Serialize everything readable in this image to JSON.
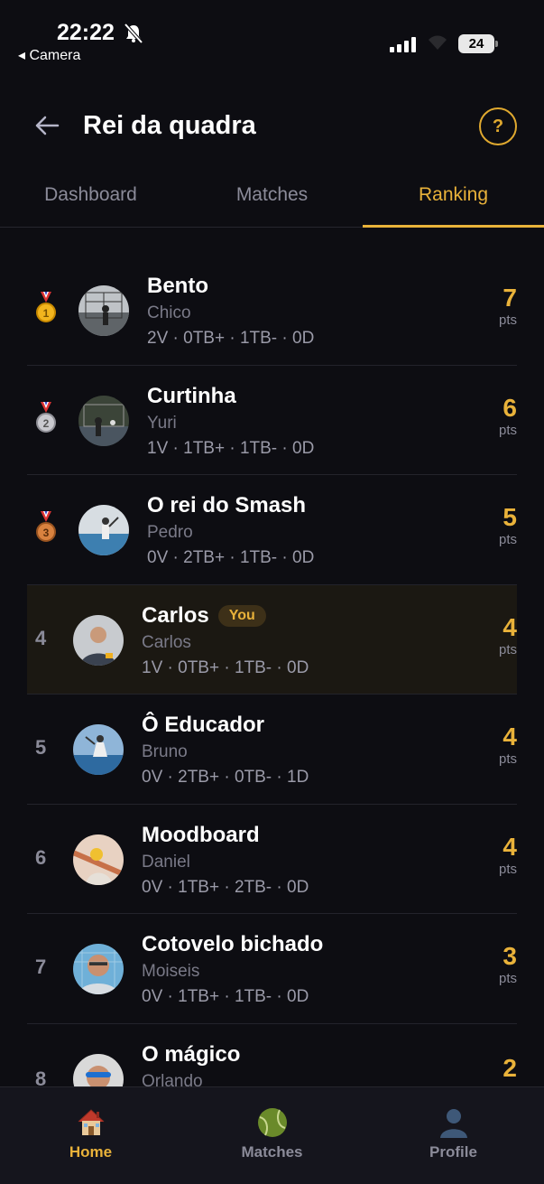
{
  "status": {
    "time": "22:22",
    "back_app": "◂ Camera",
    "battery": "24"
  },
  "header": {
    "title": "Rei da quadra",
    "help": "?"
  },
  "tabs": [
    {
      "label": "Dashboard",
      "active": false
    },
    {
      "label": "Matches",
      "active": false
    },
    {
      "label": "Ranking",
      "active": true
    }
  ],
  "ranking": [
    {
      "rank": "1",
      "medal": "gold",
      "name": "Bento",
      "player": "Chico",
      "stats": "2V · 0TB+ · 1TB- · 0D",
      "pts": "7",
      "pts_label": "pts"
    },
    {
      "rank": "2",
      "medal": "silver",
      "name": "Curtinha",
      "player": "Yuri",
      "stats": "1V · 1TB+ · 1TB- · 0D",
      "pts": "6",
      "pts_label": "pts"
    },
    {
      "rank": "3",
      "medal": "bronze",
      "name": "O rei do Smash",
      "player": "Pedro",
      "stats": "0V · 2TB+ · 1TB- · 0D",
      "pts": "5",
      "pts_label": "pts"
    },
    {
      "rank": "4",
      "name": "Carlos",
      "badge": "You",
      "player": "Carlos",
      "stats": "1V · 0TB+ · 1TB- · 0D",
      "pts": "4",
      "pts_label": "pts"
    },
    {
      "rank": "5",
      "name": "Ô Educador",
      "player": "Bruno",
      "stats": "0V · 2TB+ · 0TB- · 1D",
      "pts": "4",
      "pts_label": "pts"
    },
    {
      "rank": "6",
      "name": "Moodboard",
      "player": "Daniel",
      "stats": "0V · 1TB+ · 2TB- · 0D",
      "pts": "4",
      "pts_label": "pts"
    },
    {
      "rank": "7",
      "name": "Cotovelo bichado",
      "player": "Moiseis",
      "stats": "0V · 1TB+ · 1TB- · 0D",
      "pts": "3",
      "pts_label": "pts"
    },
    {
      "rank": "8",
      "name": "O mágico",
      "player": "Orlando",
      "stats": "",
      "pts": "2",
      "pts_label": ""
    }
  ],
  "bottom_nav": [
    {
      "label": "Home",
      "icon": "house-icon",
      "active": true
    },
    {
      "label": "Matches",
      "icon": "tennis-ball-icon",
      "active": false
    },
    {
      "label": "Profile",
      "icon": "person-icon",
      "active": false
    }
  ],
  "colors": {
    "accent": "#e9b23a",
    "background": "#0d0d12",
    "muted": "#8b8b99"
  }
}
